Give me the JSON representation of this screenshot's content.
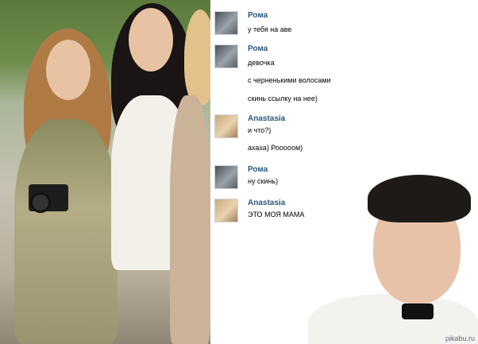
{
  "chat": {
    "messages": [
      {
        "sender": "Рома",
        "avatar": "roma-avatar",
        "lines": [
          "у тебя на аве"
        ]
      },
      {
        "sender": "Рома",
        "avatar": "roma-avatar",
        "lines": [
          "девочка",
          "с черненькими волосами",
          "скинь ссылку на нее)"
        ]
      },
      {
        "sender": "Anastasia",
        "avatar": "anastasia-avatar",
        "lines": [
          "и что?)",
          "ахаха) Рооооом)"
        ]
      },
      {
        "sender": "Рома",
        "avatar": "roma-avatar",
        "lines": [
          "ну скинь)"
        ]
      },
      {
        "sender": "Anastasia",
        "avatar": "anastasia-avatar",
        "lines": [
          "ЭТО МОЯ МАМА"
        ]
      }
    ]
  },
  "watermark": "pikabu.ru",
  "colors": {
    "sender_name": "#2b587a",
    "message_text": "#000000",
    "background": "#ffffff"
  }
}
